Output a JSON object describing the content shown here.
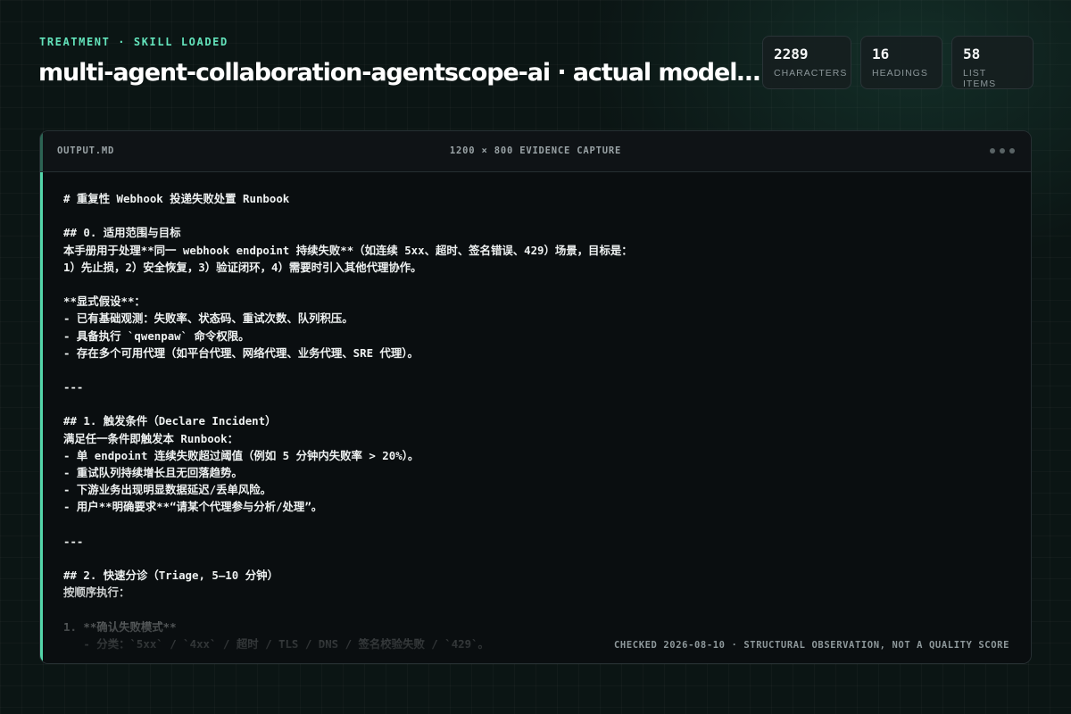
{
  "header": {
    "eyebrow": "TREATMENT · SKILL LOADED",
    "title": "multi-agent-collaboration-agentscope-ai · actual model…"
  },
  "stats": [
    {
      "value": "2289",
      "label": "CHARACTERS"
    },
    {
      "value": "16",
      "label": "HEADINGS"
    },
    {
      "value": "58",
      "label": "LIST ITEMS"
    }
  ],
  "panel": {
    "file_name": "OUTPUT.MD",
    "capture_label": "1200 × 800 EVIDENCE CAPTURE",
    "footer_note": "CHECKED 2026-08-10 · STRUCTURAL OBSERVATION, NOT A QUALITY SCORE",
    "lines": [
      "# 重复性 Webhook 投递失败处置 Runbook",
      "",
      "## 0. 适用范围与目标",
      "本手册用于处理**同一 webhook endpoint 持续失败**（如连续 5xx、超时、签名错误、429）场景，目标是：",
      "1）先止损，2）安全恢复，3）验证闭环，4）需要时引入其他代理协作。",
      "",
      "**显式假设**：",
      "- 已有基础观测：失败率、状态码、重试次数、队列积压。",
      "- 具备执行 `qwenpaw` 命令权限。",
      "- 存在多个可用代理（如平台代理、网络代理、业务代理、SRE 代理）。",
      "",
      "---",
      "",
      "## 1. 触发条件（Declare Incident）",
      "满足任一条件即触发本 Runbook：",
      "- 单 endpoint 连续失败超过阈值（例如 5 分钟内失败率 > 20%）。",
      "- 重试队列持续增长且无回落趋势。",
      "- 下游业务出现明显数据延迟/丢单风险。",
      "- 用户**明确要求**“请某个代理参与分析/处理”。",
      "",
      "---",
      "",
      "## 2. 快速分诊（Triage, 5–10 分钟）",
      "按顺序执行：",
      "",
      "1. **确认失败模式**",
      "   - 分类：`5xx` / `4xx` / 超时 / TLS / DNS / 签名校验失败 / `429`。"
    ]
  },
  "colors": {
    "accent": "#63e3bb",
    "background": "#0b1514",
    "panel": "#0a0e10"
  }
}
